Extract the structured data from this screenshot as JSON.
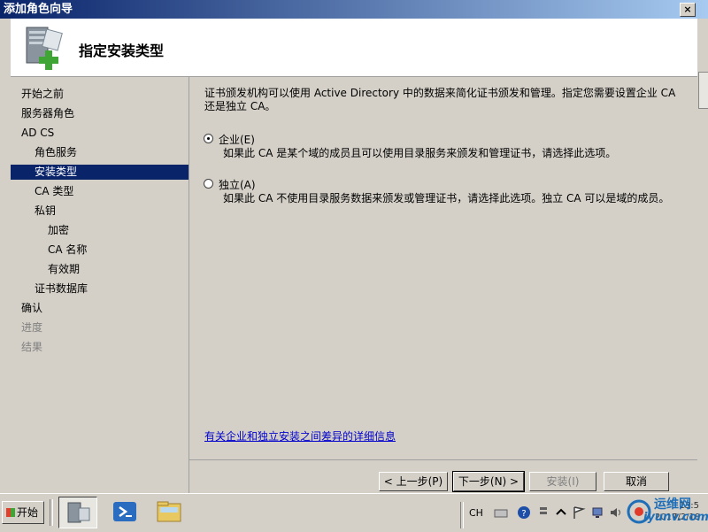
{
  "window": {
    "title": "添加角色向导",
    "close": "×"
  },
  "header": {
    "page_title": "指定安装类型"
  },
  "nav": [
    {
      "label": "开始之前",
      "state": "normal",
      "indent": 0
    },
    {
      "label": "服务器角色",
      "state": "normal",
      "indent": 0
    },
    {
      "label": "AD CS",
      "state": "normal",
      "indent": 0
    },
    {
      "label": "角色服务",
      "state": "normal",
      "indent": 1
    },
    {
      "label": "安装类型",
      "state": "selected",
      "indent": 1
    },
    {
      "label": "CA 类型",
      "state": "normal",
      "indent": 1
    },
    {
      "label": "私钥",
      "state": "normal",
      "indent": 1
    },
    {
      "label": "加密",
      "state": "normal",
      "indent": 2
    },
    {
      "label": "CA 名称",
      "state": "normal",
      "indent": 2
    },
    {
      "label": "有效期",
      "state": "normal",
      "indent": 2
    },
    {
      "label": "证书数据库",
      "state": "normal",
      "indent": 1
    },
    {
      "label": "确认",
      "state": "normal",
      "indent": 0
    },
    {
      "label": "进度",
      "state": "disabled",
      "indent": 0
    },
    {
      "label": "结果",
      "state": "disabled",
      "indent": 0
    }
  ],
  "content": {
    "description_line1": "证书颁发机构可以使用 Active Directory 中的数据来简化证书颁发和管理。指定您需要设置企业 CA",
    "description_line2": "还是独立 CA。",
    "option_enterprise": {
      "label": "企业(E)",
      "checked": true,
      "desc": "如果此 CA 是某个域的成员且可以使用目录服务来颁发和管理证书，请选择此选项。"
    },
    "option_standalone": {
      "label": "独立(A)",
      "checked": false,
      "desc": "如果此 CA 不使用目录服务数据来颁发或管理证书，请选择此选项。独立 CA 可以是域的成员。"
    },
    "help_link": "有关企业和独立安装之间差异的详细信息"
  },
  "buttons": {
    "back": "< 上一步(P)",
    "next": "下一步(N) >",
    "install": "安装(I)",
    "cancel": "取消"
  },
  "taskbar": {
    "start": "开始",
    "lang": "CH",
    "clock_line1": "13:5",
    "clock_line2": "2017/2/18"
  },
  "watermark": {
    "line1": "运维网",
    "line2": "iyunv.com"
  },
  "colors": {
    "selection": "#0a246a",
    "link": "#0000cc",
    "title_gradient_start": "#0a246a"
  }
}
